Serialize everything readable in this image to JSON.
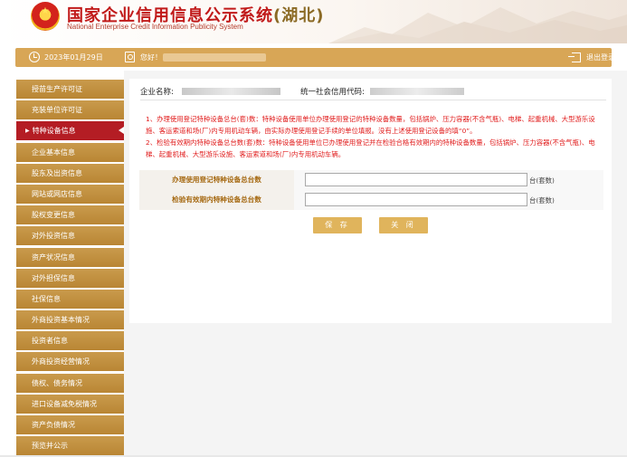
{
  "header": {
    "title": "国家企业信用信息公示系统",
    "province": "(湖北)",
    "subtitle": "National Enterprise Credit Information Publicity System"
  },
  "topbar": {
    "date": "2023年01月29日",
    "greeting": "您好！",
    "logout_label": "退出登录"
  },
  "sidebar": {
    "items": [
      {
        "label": "授苗生产许可证",
        "active": false
      },
      {
        "label": "充装单位许可证",
        "active": false
      },
      {
        "label": "特种设备信息",
        "active": true
      },
      {
        "label": "企业基本信息",
        "active": false
      },
      {
        "label": "股东及出资信息",
        "active": false
      },
      {
        "label": "网站或网店信息",
        "active": false
      },
      {
        "label": "股权变更信息",
        "active": false
      },
      {
        "label": "对外投资信息",
        "active": false
      },
      {
        "label": "资产状况信息",
        "active": false
      },
      {
        "label": "对外担保信息",
        "active": false
      },
      {
        "label": "社保信息",
        "active": false
      },
      {
        "label": "外商投资基本情况",
        "active": false
      },
      {
        "label": "投资者信息",
        "active": false
      },
      {
        "label": "外商投资经营情况",
        "active": false
      },
      {
        "label": "债权、债务情况",
        "active": false
      },
      {
        "label": "进口设备减免税情况",
        "active": false
      },
      {
        "label": "资产负债情况",
        "active": false
      },
      {
        "label": "预览并公示",
        "active": false
      }
    ]
  },
  "main": {
    "company_name_label": "企业名称:",
    "credit_code_label": "统一社会信用代码:",
    "note1": "1、办理使用登记特种设备总台(套)数：特种设备使用单位办理使用登记的特种设备数量，包括锅炉、压力容器(不含气瓶)、电梯、起重机械、大型游乐设施、客运索道和场(厂)内专用机动车辆，由实际办理使用登记手续的单位填报。没有上述使用登记设备的填“0”。",
    "note2": "2、检验有效期内特种设备总台数(套)数：特种设备使用单位已办理使用登记并在检验合格有效期内的特种设备数量，包括锅炉、压力容器(不含气瓶)、电梯、起重机械、大型游乐设施、客运索道和场(厂)内专用机动车辆。",
    "fields": [
      {
        "label": "办理使用登记特种设备总台数",
        "value": "",
        "unit": "台(套数)"
      },
      {
        "label": "检验有效期内特种设备总台数",
        "value": "",
        "unit": "台(套数)"
      }
    ],
    "save_label": "保 存",
    "close_label": "关 闭"
  },
  "colors": {
    "brand_red": "#c11a1a",
    "sidebar_gold": "#c99a4c",
    "sidebar_active": "#b41d24",
    "button_gold": "#e0b45c",
    "note_red": "#e11d1d"
  }
}
